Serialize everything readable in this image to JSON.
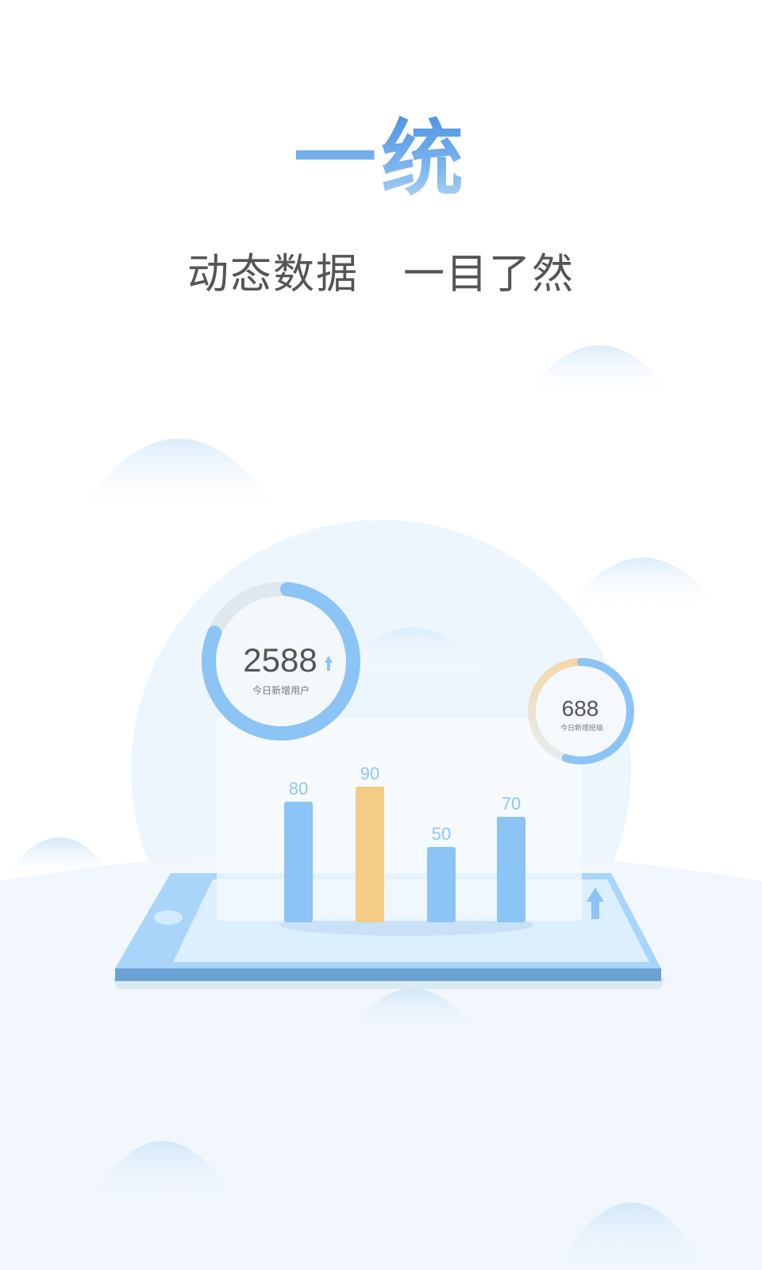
{
  "title": "一统",
  "subtitle": {
    "part1": "动态数据",
    "part2": "一目了然"
  },
  "stats": {
    "users": {
      "value": "2588",
      "label": "今日新增用户",
      "progress": 0.8,
      "trend_icon": "arrow-up-icon"
    },
    "classes": {
      "value": "688",
      "label": "今日新增班级",
      "progress": 0.55,
      "trend_icon": "arrow-up-icon"
    }
  },
  "chart_data": {
    "type": "bar",
    "categories": [
      "",
      "",
      "",
      ""
    ],
    "values": [
      80,
      90,
      50,
      70
    ],
    "value_labels": [
      "80",
      "90",
      "50",
      "70"
    ],
    "colors": [
      "#8cc4f6",
      "#f4cc86",
      "#8cc4f6",
      "#8cc4f6"
    ],
    "title": "",
    "xlabel": "",
    "ylabel": "",
    "ylim": [
      0,
      100
    ],
    "grid": false
  },
  "colors": {
    "primary": "#4a90e2",
    "bar_blue": "#8cc4f6",
    "bar_orange": "#f4cc86",
    "ring_track": "#dfe7ef",
    "bg_light": "#eef6fd"
  }
}
